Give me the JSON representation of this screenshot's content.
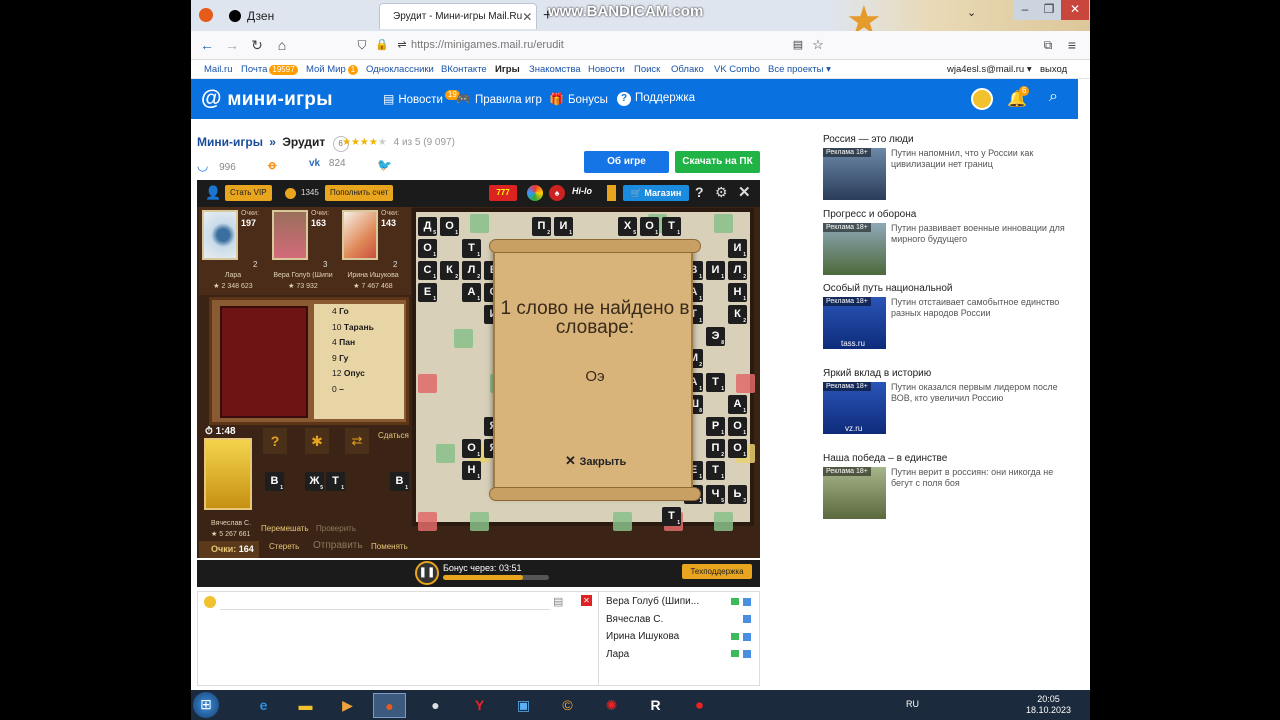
{
  "browser": {
    "tabs": [
      {
        "label": "Дзен"
      },
      {
        "label": "Эрудит - Мини-игры Mail.Ru"
      }
    ],
    "url": "https://minigames.mail.ru/erudit",
    "watermark": "www.BANDICAM.com"
  },
  "portal_bar": {
    "links": [
      "Mail.ru",
      "Почта",
      "Мой Мир",
      "Одноклассники",
      "ВКонтакте",
      "Игры",
      "Знакомства",
      "Новости",
      "Поиск",
      "Облако",
      "VK Combo",
      "Все проекты"
    ],
    "mail_badge": "19597",
    "mir_badge": "1",
    "user_email": "wja4esl.s@mail.ru",
    "logout": "выход"
  },
  "header": {
    "logo": "мини-игры",
    "nav": [
      {
        "label": "Новости",
        "badge": "19",
        "icon": "news-icon"
      },
      {
        "label": "Правила игр",
        "icon": "gamepad-icon"
      },
      {
        "label": "Бонусы",
        "icon": "gift-icon"
      },
      {
        "label": "Поддержка",
        "icon": "help-icon"
      }
    ],
    "notify_badge": "6"
  },
  "page": {
    "breadcrumb_root": "Мини-игры",
    "breadcrumb_sep": "»",
    "game_title": "Эрудит",
    "game_count": "6",
    "rating_text": "4 из 5 (9 097)",
    "likes": "996",
    "vk_count": "824",
    "about_button": "Об игре",
    "download_button": "Скачать на ПК"
  },
  "game": {
    "vip_button": "Стать VIP",
    "coins": "1345",
    "topup_button": "Пополнить счет",
    "shop_button": "Магазин",
    "score_label": "Очки:",
    "players": [
      {
        "name": "Лара",
        "score": "197",
        "points": "2 348 623",
        "tiles_left": "2"
      },
      {
        "name": "Вера Голуб (Шипи",
        "score": "163",
        "points": "73 932",
        "tiles_left": "3"
      },
      {
        "name": "Ирина Ишукова",
        "score": "143",
        "points": "7 467 468",
        "tiles_left": "2"
      }
    ],
    "history": [
      {
        "pts": "4",
        "word": "Го"
      },
      {
        "pts": "10",
        "word": "Тарань"
      },
      {
        "pts": "4",
        "word": "Пан"
      },
      {
        "pts": "9",
        "word": "Гу"
      },
      {
        "pts": "12",
        "word": "Опус"
      },
      {
        "pts": "0",
        "word": "–"
      }
    ],
    "timer": "1:48",
    "surrender": "Сдаться",
    "me": {
      "name": "Вячеслав С.",
      "points": "5 267 661",
      "score_label": "Очки:",
      "score": "164"
    },
    "controls": {
      "shuffle": "Перемешать",
      "check": "Проверить",
      "erase": "Стереть",
      "send": "Отправить",
      "swap": "Поменять"
    },
    "hand_tiles": [
      {
        "letter": "В",
        "val": "1"
      },
      {
        "letter": "Ж",
        "val": "5"
      },
      {
        "letter": "Т",
        "val": "1"
      },
      {
        "letter": "В",
        "val": "1"
      }
    ],
    "board_tiles": [
      {
        "letter": "Д",
        "val": "5"
      },
      {
        "letter": "О",
        "val": "1"
      },
      {
        "letter": "П",
        "val": "2"
      },
      {
        "letter": "И",
        "val": "1"
      },
      {
        "letter": "Х",
        "val": "5"
      },
      {
        "letter": "О",
        "val": "1"
      },
      {
        "letter": "Т",
        "val": "1"
      },
      {
        "letter": "О",
        "val": "1"
      },
      {
        "letter": "Т",
        "val": "1"
      },
      {
        "letter": "Г",
        "val": "3"
      },
      {
        "letter": "У",
        "val": "2"
      },
      {
        "letter": "Б",
        "val": "3"
      },
      {
        "letter": "Ы",
        "val": "4"
      },
      {
        "letter": "Р",
        "val": "1"
      },
      {
        "letter": "И",
        "val": "1"
      },
      {
        "letter": "С",
        "val": "1"
      },
      {
        "letter": "К",
        "val": "2"
      },
      {
        "letter": "Л",
        "val": "2"
      },
      {
        "letter": "Е",
        "val": "1"
      },
      {
        "letter": "В",
        "val": "1"
      },
      {
        "letter": "И",
        "val": "1"
      },
      {
        "letter": "Л",
        "val": "2"
      },
      {
        "letter": "Е",
        "val": "1"
      },
      {
        "letter": "А",
        "val": "1"
      },
      {
        "letter": "С",
        "val": "1"
      },
      {
        "letter": "А",
        "val": "1"
      },
      {
        "letter": "Н",
        "val": "1"
      },
      {
        "letter": "И",
        "val": "1"
      },
      {
        "letter": "Т",
        "val": "1"
      },
      {
        "letter": "К",
        "val": "2"
      },
      {
        "letter": "Э",
        "val": "8"
      },
      {
        "letter": "М",
        "val": "2"
      },
      {
        "letter": "А",
        "val": "1"
      },
      {
        "letter": "Т",
        "val": "1"
      },
      {
        "letter": "Я",
        "val": "3"
      },
      {
        "letter": "Ш",
        "val": "8"
      },
      {
        "letter": "А",
        "val": "1"
      },
      {
        "letter": "Р",
        "val": "1"
      },
      {
        "letter": "О",
        "val": "1"
      },
      {
        "letter": "Я",
        "val": "3"
      },
      {
        "letter": "О",
        "val": "1"
      },
      {
        "letter": "О",
        "val": "1"
      },
      {
        "letter": "П",
        "val": "2"
      },
      {
        "letter": "Н",
        "val": "1"
      },
      {
        "letter": "Е",
        "val": "1"
      },
      {
        "letter": "Т",
        "val": "1"
      },
      {
        "letter": "А",
        "val": "1"
      },
      {
        "letter": "Ч",
        "val": "5"
      },
      {
        "letter": "Ь",
        "val": "3"
      },
      {
        "letter": "Т",
        "val": "1"
      }
    ],
    "dialog": {
      "title": "1 слово не найдено в словаре:",
      "word": "Оэ",
      "close": "Закрыть"
    },
    "bonus_text": "Бонус через:",
    "bonus_time": "03:51",
    "bonus_progress": 0.75,
    "support_button": "Техподдержка"
  },
  "chat": {
    "online": [
      {
        "name": "Вера Голуб (Шипи..."
      },
      {
        "name": "Вячеслав С."
      },
      {
        "name": "Ирина Ишукова"
      },
      {
        "name": "Лара"
      }
    ]
  },
  "news": [
    {
      "heading": "Россия — это люди",
      "ad": "Реклама 18+",
      "text": "Путин напомнил, что у России как цивилизации нет границ",
      "source": ""
    },
    {
      "heading": "Прогресс и оборона",
      "ad": "Реклама 18+",
      "text": "Путин развивает военные инновации для мирного будущего",
      "source": ""
    },
    {
      "heading": "Особый путь национальной",
      "ad": "Реклама 18+",
      "text": "Путин отстаивает самобытное единство разных народов России",
      "source": "tass.ru"
    },
    {
      "heading": "Яркий вклад в историю",
      "ad": "Реклама 18+",
      "text": "Путин оказался первым лидером после ВОВ, кто увеличил Россию",
      "source": "vz.ru"
    },
    {
      "heading": "Наша победа – в единстве",
      "ad": "Реклама 18+",
      "text": "Путин верит в россиян: они никогда не бегут с поля боя",
      "source": ""
    }
  ],
  "taskbar": {
    "lang": "RU",
    "time": "20:05",
    "date": "18.10.2023"
  }
}
